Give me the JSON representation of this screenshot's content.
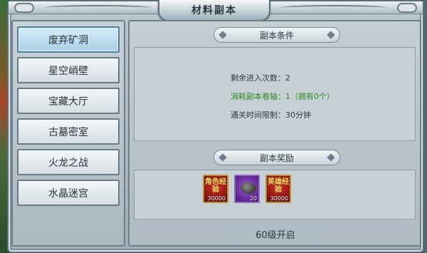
{
  "window": {
    "title": "材料副本"
  },
  "sidebar": {
    "items": [
      {
        "label": "废弃矿洞",
        "active": true
      },
      {
        "label": "星空峭壁",
        "active": false
      },
      {
        "label": "宝藏大厅",
        "active": false
      },
      {
        "label": "古墓密室",
        "active": false
      },
      {
        "label": "火龙之战",
        "active": false
      },
      {
        "label": "水晶迷宫",
        "active": false
      }
    ]
  },
  "conditions": {
    "header": "副本条件",
    "lines": [
      {
        "text": "剩余进入次数：2",
        "color": "#2f3a42"
      },
      {
        "text": "消耗副本卷轴：1（拥有0个）",
        "color": "#2c8a1f"
      },
      {
        "text": "通关时间限制：30分钟",
        "color": "#2f3a42"
      }
    ]
  },
  "rewards": {
    "header": "副本奖励",
    "items": [
      {
        "icon": "role-exp-icon",
        "label": "角色经验",
        "quantity": "30000"
      },
      {
        "icon": "ore-icon",
        "label": "",
        "quantity": "20"
      },
      {
        "icon": "hero-exp-icon",
        "label": "英雄经验",
        "quantity": "30000"
      }
    ]
  },
  "footer": {
    "unlock_text": "60级开启"
  },
  "colors": {
    "active_tab": "#a9d0e8",
    "frame": "#b9c7d0",
    "highlight_green": "#2c8a1f"
  }
}
